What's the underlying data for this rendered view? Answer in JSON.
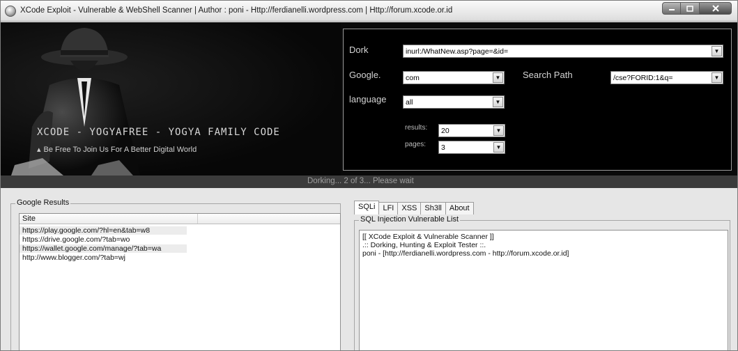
{
  "window": {
    "title": "XCode Exploit - Vulnerable & WebShell Scanner | Author : poni  - Http://ferdianelli.wordpress.com | Http://forum.xcode.or.id"
  },
  "banner": {
    "title": "XCODE - YOGYAFREE - YOGYA FAMILY CODE",
    "subtitle": "Be Free To Join Us For A Better Digital World"
  },
  "search": {
    "dork_label": "Dork",
    "dork_value": "inurl:/WhatNew.asp?page=&id=",
    "google_label": "Google.",
    "google_value": "com",
    "search_path_label": "Search Path",
    "search_path_value": "/cse?FORID:1&q=",
    "language_label": "language",
    "language_value": "all",
    "results_label": "results:",
    "results_value": "20",
    "pages_label": "pages:",
    "pages_value": "3"
  },
  "status": {
    "text": "Dorking... 2 of 3... Please wait"
  },
  "google_results": {
    "group_title": "Google Results",
    "column_header": "Site",
    "rows": [
      "https://play.google.com/?hl=en&tab=w8",
      "https://drive.google.com/?tab=wo",
      "https://wallet.google.com/manage/?tab=wa",
      "http://www.blogger.com/?tab=wj"
    ]
  },
  "tabs": [
    "SQLi",
    "LFI",
    "XSS",
    "Sh3ll",
    "About"
  ],
  "sqli": {
    "group_title": "SQL Injection Vulnerable List",
    "lines": [
      "[[ XCode Exploit & Vulnerable Scanner ]]",
      ".:: Dorking, Hunting & Exploit Tester ::.",
      "poni - [http://ferdianelli.wordpress.com - http://forum.xcode.or.id]"
    ]
  }
}
